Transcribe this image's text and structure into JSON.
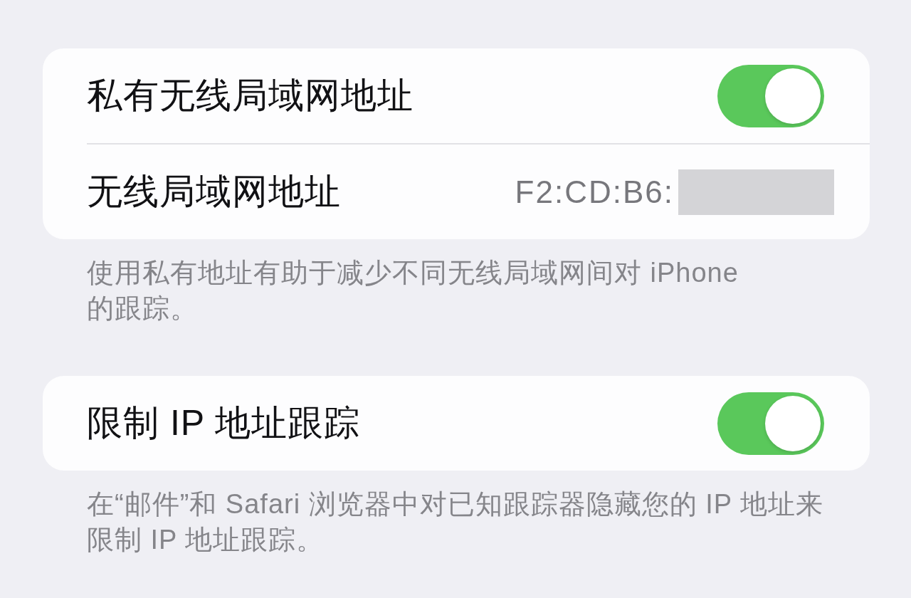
{
  "groups": [
    {
      "rows": [
        {
          "kind": "toggle",
          "label": "私有无线局域网地址",
          "on": true
        },
        {
          "kind": "value",
          "label": "无线局域网地址",
          "value": "F2:CD:B6:",
          "redacted": true
        }
      ],
      "footer": "使用私有地址有助于减少不同无线局域网间对 iPhone 的跟踪。"
    },
    {
      "rows": [
        {
          "kind": "toggle",
          "label": "限制 IP 地址跟踪",
          "on": true
        }
      ],
      "footer": "在“邮件”和 Safari 浏览器中对已知跟踪器隐藏您的 IP 地址来限制 IP 地址跟踪。"
    }
  ]
}
